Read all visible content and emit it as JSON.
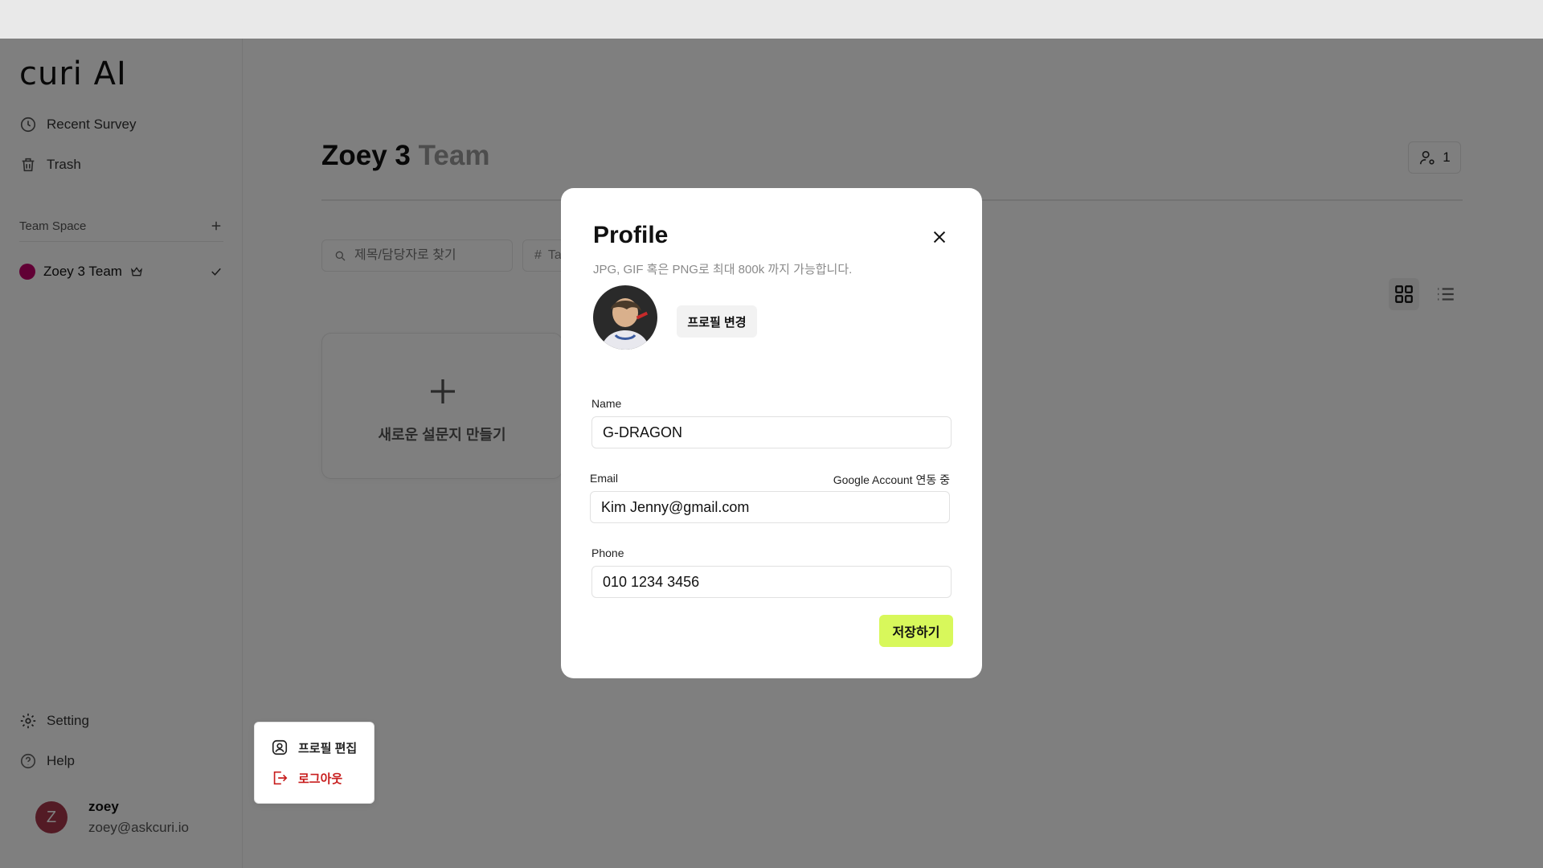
{
  "app": {
    "logo_text": "curi AI"
  },
  "sidebar": {
    "nav": [
      {
        "label": "Recent Survey",
        "icon": "clock-icon"
      },
      {
        "label": "Trash",
        "icon": "trash-icon"
      }
    ],
    "team_space_label": "Team Space",
    "team": {
      "name": "Zoey 3 Team",
      "color": "#c2006b"
    },
    "bottom": [
      {
        "label": "Setting",
        "icon": "gear-icon"
      },
      {
        "label": "Help",
        "icon": "help-icon"
      }
    ],
    "user": {
      "initial": "Z",
      "name": "zoey",
      "email": "zoey@askcuri.io",
      "avatar_color": "#a6374a"
    }
  },
  "popup_menu": {
    "items": [
      {
        "label": "프로필 편집",
        "icon": "user-profile-icon"
      },
      {
        "label": "로그아웃",
        "icon": "logout-icon"
      }
    ],
    "logout_color": "#c81e1e"
  },
  "main": {
    "title_primary": "Zoey 3",
    "title_secondary": "Team",
    "member_count": "1",
    "search_placeholder": "제목/담당자로 찾기",
    "tag_label": "Ta",
    "new_card_label": "새로운 설문지 만들기"
  },
  "modal": {
    "title": "Profile",
    "subtitle": "JPG, GIF 혹은 PNG로 최대 800k 까지 가능합니다.",
    "change_button": "프로필 변경",
    "name_label": "Name",
    "name_value": "G-DRAGON",
    "email_label": "Email",
    "email_aux": "Google Account 연동 중",
    "email_value": "Kim Jenny@gmail.com",
    "phone_label": "Phone",
    "phone_value": "010 1234 3456",
    "save_button": "저장하기",
    "save_color": "#d8f85b"
  }
}
